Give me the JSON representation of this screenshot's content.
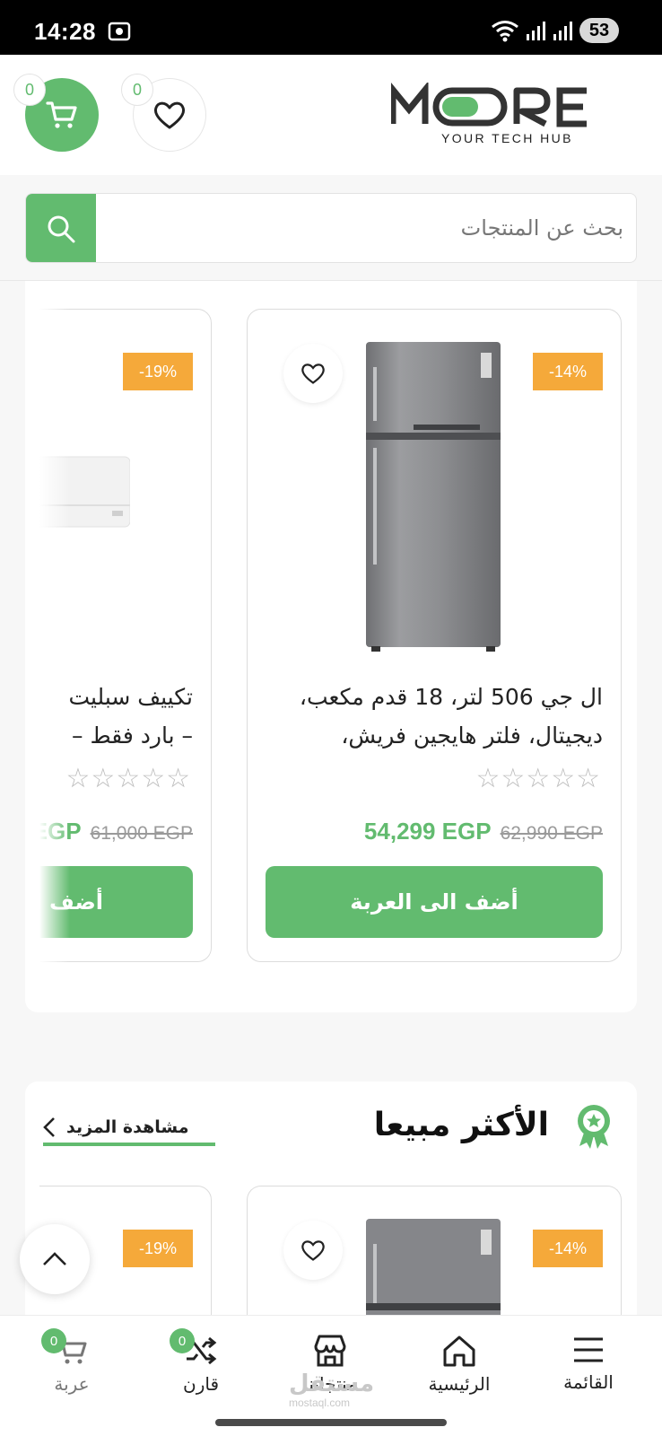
{
  "status_bar": {
    "time": "14:28",
    "battery": "53"
  },
  "header": {
    "cart_count": "0",
    "wishlist_count": "0",
    "logo_text": "MORE",
    "logo_tagline": "YOUR TECH HUB",
    "brand_color": "#62bb6f"
  },
  "search": {
    "placeholder": "بحث عن المنتجات"
  },
  "products": [
    {
      "discount": "-14%",
      "title_line1": "ال جي 506 لتر، 18 قدم مكعب،",
      "title_line2": "ديجيتال، فلتر هايجين فريش،",
      "rating": 0,
      "price_new": "54,299 EGP",
      "price_old": "62,990 EGP",
      "add_label": "أضف الى العربة"
    },
    {
      "discount": "-19%",
      "title_line1": "تكييف سبليت",
      "title_line2": "– بارد فقط –",
      "rating": 0,
      "price_new": "EGP",
      "price_old": "61,000 EGP",
      "add_label": "أضف ا"
    }
  ],
  "bestsellers": {
    "title": "الأكثر مبيعا",
    "see_more": "مشاهدة المزيد",
    "items": [
      {
        "discount": "-14%"
      },
      {
        "discount": "-19%"
      }
    ]
  },
  "bottom_nav": {
    "menu": "القائمة",
    "home": "الرئيسية",
    "products": "منتجاتنا",
    "compare": "قارن",
    "compare_count": "0",
    "cart": "عربة",
    "cart_count": "0"
  },
  "watermark": {
    "text": "مستقل",
    "sub": "mostaql.com"
  }
}
